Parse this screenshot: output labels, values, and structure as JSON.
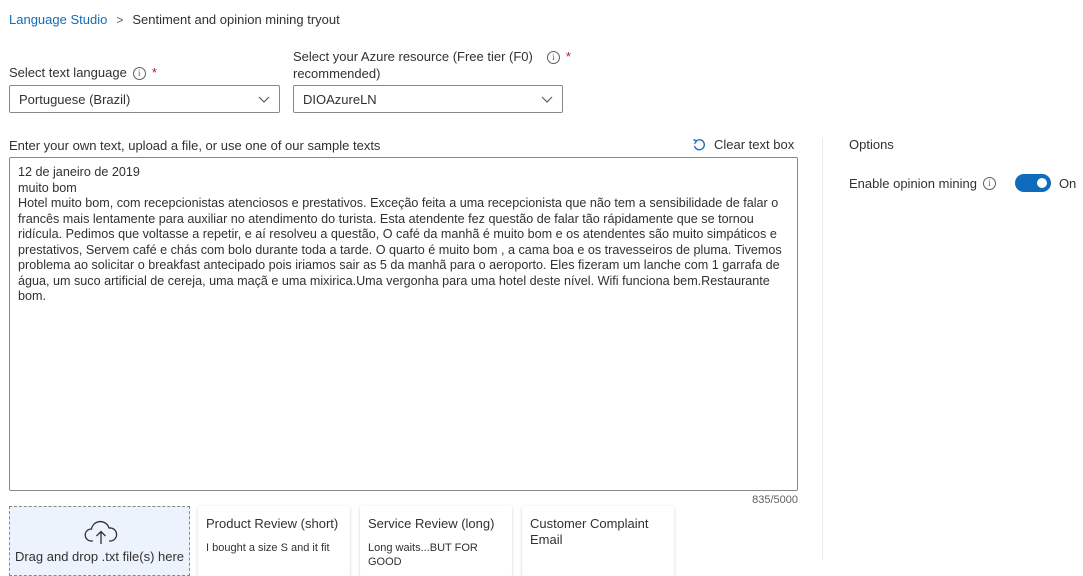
{
  "breadcrumb": {
    "home": "Language Studio",
    "separator": ">",
    "current": "Sentiment and opinion mining tryout"
  },
  "language": {
    "label": "Select text language",
    "required_mark": "*",
    "info_icon": "i",
    "value": "Portuguese (Brazil)"
  },
  "resource": {
    "label_line1": "Select your Azure resource (Free tier (F0)",
    "label_line2": "recommended)",
    "required_mark": "*",
    "info_icon": "i",
    "value": "DIOAzureLN"
  },
  "input": {
    "label": "Enter your own text, upload a file, or use one of our sample texts",
    "clear_label": "Clear text box",
    "text": "12 de janeiro de 2019\nmuito bom\nHotel muito bom, com recepcionistas atenciosos e prestativos. Exceção feita a uma recepcionista que não tem a sensibilidade de falar o francês mais lentamente para auxiliar no atendimento do turista. Esta atendente fez questão de falar tão rápidamente que se tornou ridícula. Pedimos que voltasse a repetir, e aí resolveu a questão, O café da manhã é muito bom e os atendentes são muito simpáticos e prestativos, Servem café e chás com bolo durante toda a tarde. O quarto é muito bom , a cama boa e os travesseiros de pluma. Tivemos problema ao solicitar o breakfast antecipado pois iriamos sair as 5 da manhã para o aeroporto. Eles fizeram um lanche com 1 garrafa de água, um suco artificial de cereja, uma maçã e uma mixirica.Uma vergonha para uma hotel deste nível. Wifi funciona bem.Restaurante bom.",
    "counter": "835/5000"
  },
  "options": {
    "title": "Options",
    "opinion_label": "Enable opinion mining",
    "info_icon": "i",
    "toggle_state": "On",
    "toggle_on": true
  },
  "upload": {
    "text": "Drag and drop .txt file(s) here",
    "icon": "cloud-upload-icon"
  },
  "samples": [
    {
      "title": "Product Review (short)",
      "snippet": "I bought a size S and it fit"
    },
    {
      "title": "Service Review (long)",
      "snippet": "Long waits...BUT FOR GOOD"
    },
    {
      "title": "Customer Complaint Email",
      "snippet": ""
    }
  ],
  "colors": {
    "accent": "#0f6cbd",
    "required": "#a4262c",
    "dropzone_bg": "#edf3fc"
  }
}
